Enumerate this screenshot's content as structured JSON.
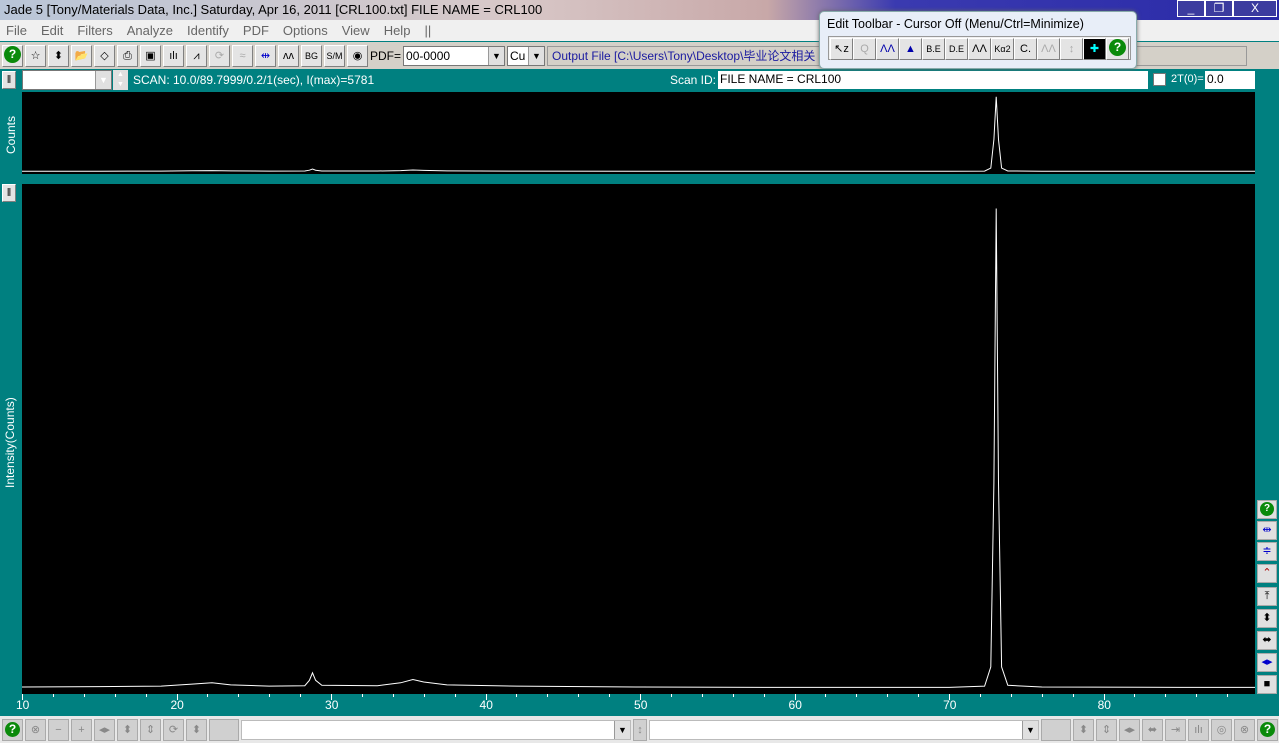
{
  "window": {
    "title": "Jade 5 [Tony/Materials Data, Inc.] Saturday, Apr 16, 2011 [CRL100.txt] FILE NAME   = CRL100",
    "minimize": "_",
    "maximize": "❐",
    "close": "X"
  },
  "menu": [
    "File",
    "Edit",
    "Filters",
    "Analyze",
    "Identify",
    "PDF",
    "Options",
    "View",
    "Help",
    "||"
  ],
  "toolbar": {
    "pdf_label": "PDF=",
    "pdf_value": "00-0000",
    "radiation": "Cu",
    "output_file": "Output File [C:\\Users\\Tony\\Desktop\\毕业论文相关"
  },
  "edit_toolbar": {
    "title": "Edit Toolbar - Cursor Off (Menu/Ctrl=Minimize)",
    "buttons": [
      "↖z",
      "Q",
      "ΛΛ",
      "▲",
      "B.E",
      "D.E",
      "ΛΛ",
      "Kα2",
      "C.",
      "ΛΛ",
      "↕",
      "✚",
      "?"
    ]
  },
  "scan": {
    "file": "CRL100.txt",
    "info": "SCAN: 10.0/89.7999/0.2/1(sec), I(max)=5781",
    "scan_id_label": "Scan ID:",
    "scan_id": "FILE NAME   = CRL100",
    "two_theta_label": "2T(0)=",
    "two_theta_value": "0.0"
  },
  "top_plot": {
    "ylabel": "Counts"
  },
  "chart_data": {
    "type": "line",
    "xlabel": "",
    "ylabel": "Intensity(Counts)",
    "xlim": [
      10,
      89.8
    ],
    "ylim": [
      0,
      6050
    ],
    "x_ticks": [
      10,
      20,
      30,
      40,
      50,
      60,
      70,
      80
    ],
    "points": [
      [
        10,
        60
      ],
      [
        15,
        65
      ],
      [
        19,
        70
      ],
      [
        21,
        95
      ],
      [
        22.3,
        110
      ],
      [
        23.5,
        85
      ],
      [
        26,
        70
      ],
      [
        28.3,
        75
      ],
      [
        28.6,
        140
      ],
      [
        28.8,
        230
      ],
      [
        29.0,
        140
      ],
      [
        29.4,
        80
      ],
      [
        33,
        75
      ],
      [
        34.5,
        110
      ],
      [
        35.3,
        150
      ],
      [
        36,
        120
      ],
      [
        37.5,
        85
      ],
      [
        42,
        70
      ],
      [
        50,
        60
      ],
      [
        60,
        55
      ],
      [
        70,
        55
      ],
      [
        72.3,
        70
      ],
      [
        72.7,
        300
      ],
      [
        72.9,
        2500
      ],
      [
        73.05,
        5781
      ],
      [
        73.2,
        2500
      ],
      [
        73.4,
        300
      ],
      [
        73.8,
        80
      ],
      [
        76,
        60
      ],
      [
        85,
        55
      ],
      [
        89.8,
        55
      ]
    ]
  },
  "bottom": {
    "left_combo": "",
    "right_combo": ""
  }
}
